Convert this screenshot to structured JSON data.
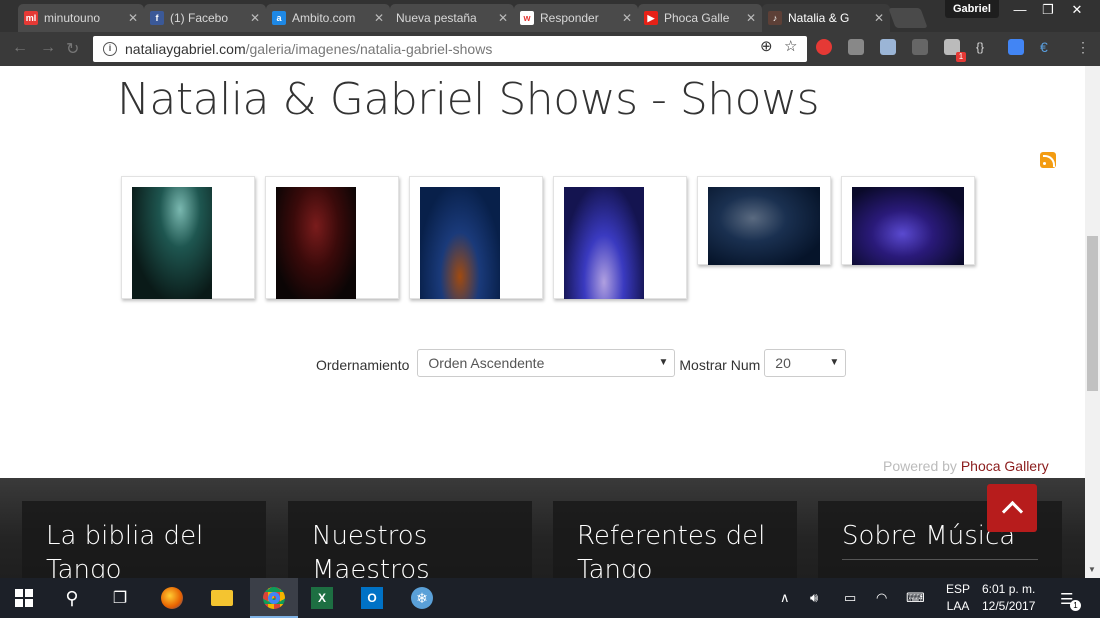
{
  "browser": {
    "tabs": [
      {
        "label": "minutouno",
        "favicon": "ml-icon",
        "color": "#e53935"
      },
      {
        "label": "(1) Facebo",
        "favicon": "facebook-icon",
        "color": "#3b5998"
      },
      {
        "label": "Ambito.com",
        "favicon": "ambito-icon",
        "color": "#1e88e5"
      },
      {
        "label": "Nueva pestaña",
        "favicon": "",
        "color": ""
      },
      {
        "label": "Responder",
        "favicon": "responder-icon",
        "color": "#e53935"
      },
      {
        "label": "Phoca Galle",
        "favicon": "youtube-icon",
        "color": "#e62117"
      },
      {
        "label": "Natalia & G",
        "favicon": "tango-icon",
        "color": "#5d4037"
      }
    ],
    "profile_name": "Gabriel",
    "url_domain": "nataliaygabriel.com",
    "url_path": "/galeria/imagenes/natalia-gabriel-shows",
    "extension_badge": "1"
  },
  "page": {
    "title": "Natalia & Gabriel Shows - Shows",
    "thumbnails": [
      {
        "name": "show-photo-1",
        "orientation": "portrait",
        "colors": [
          "#0d3d3a",
          "#3e6e6a",
          "#0a1a18"
        ]
      },
      {
        "name": "show-photo-2",
        "orientation": "portrait",
        "colors": [
          "#2a0a0a",
          "#5a1010",
          "#0b0505"
        ]
      },
      {
        "name": "show-photo-3",
        "orientation": "portrait",
        "colors": [
          "#08204a",
          "#1a3a7a",
          "#7a3010"
        ]
      },
      {
        "name": "show-photo-4",
        "orientation": "portrait",
        "colors": [
          "#141450",
          "#2a2aa0",
          "#6a5aa0"
        ]
      },
      {
        "name": "show-photo-5",
        "orientation": "landscape",
        "colors": [
          "#06142a",
          "#1a3050",
          "#4a4a5a"
        ]
      },
      {
        "name": "show-photo-6",
        "orientation": "landscape",
        "colors": [
          "#0a0a2a",
          "#3a2a9a",
          "#1a1030"
        ]
      }
    ],
    "sort_label": "Ordernamiento",
    "sort_value": "Orden Ascendente",
    "count_label": "Mostrar Num",
    "count_value": "20",
    "powered_prefix": "Powered by",
    "powered_link": "Phoca Gallery"
  },
  "footer": {
    "cards": [
      {
        "title_line1": "La biblia del",
        "title_line2": "Tango"
      },
      {
        "title_line1": "Nuestros",
        "title_line2": "Maestros"
      },
      {
        "title_line1": "Referentes del",
        "title_line2": "Tango"
      },
      {
        "title_line1": "Sobre Música",
        "title_line2": ""
      }
    ]
  },
  "taskbar": {
    "language_top": "ESP",
    "language_bottom": "LAA",
    "time": "6:01 p. m.",
    "date": "12/5/2017",
    "notification_count": "1"
  },
  "colors": {
    "accent_red": "#b71c1c",
    "link_red": "#8b1c1c",
    "rss_orange": "#f39c12"
  }
}
